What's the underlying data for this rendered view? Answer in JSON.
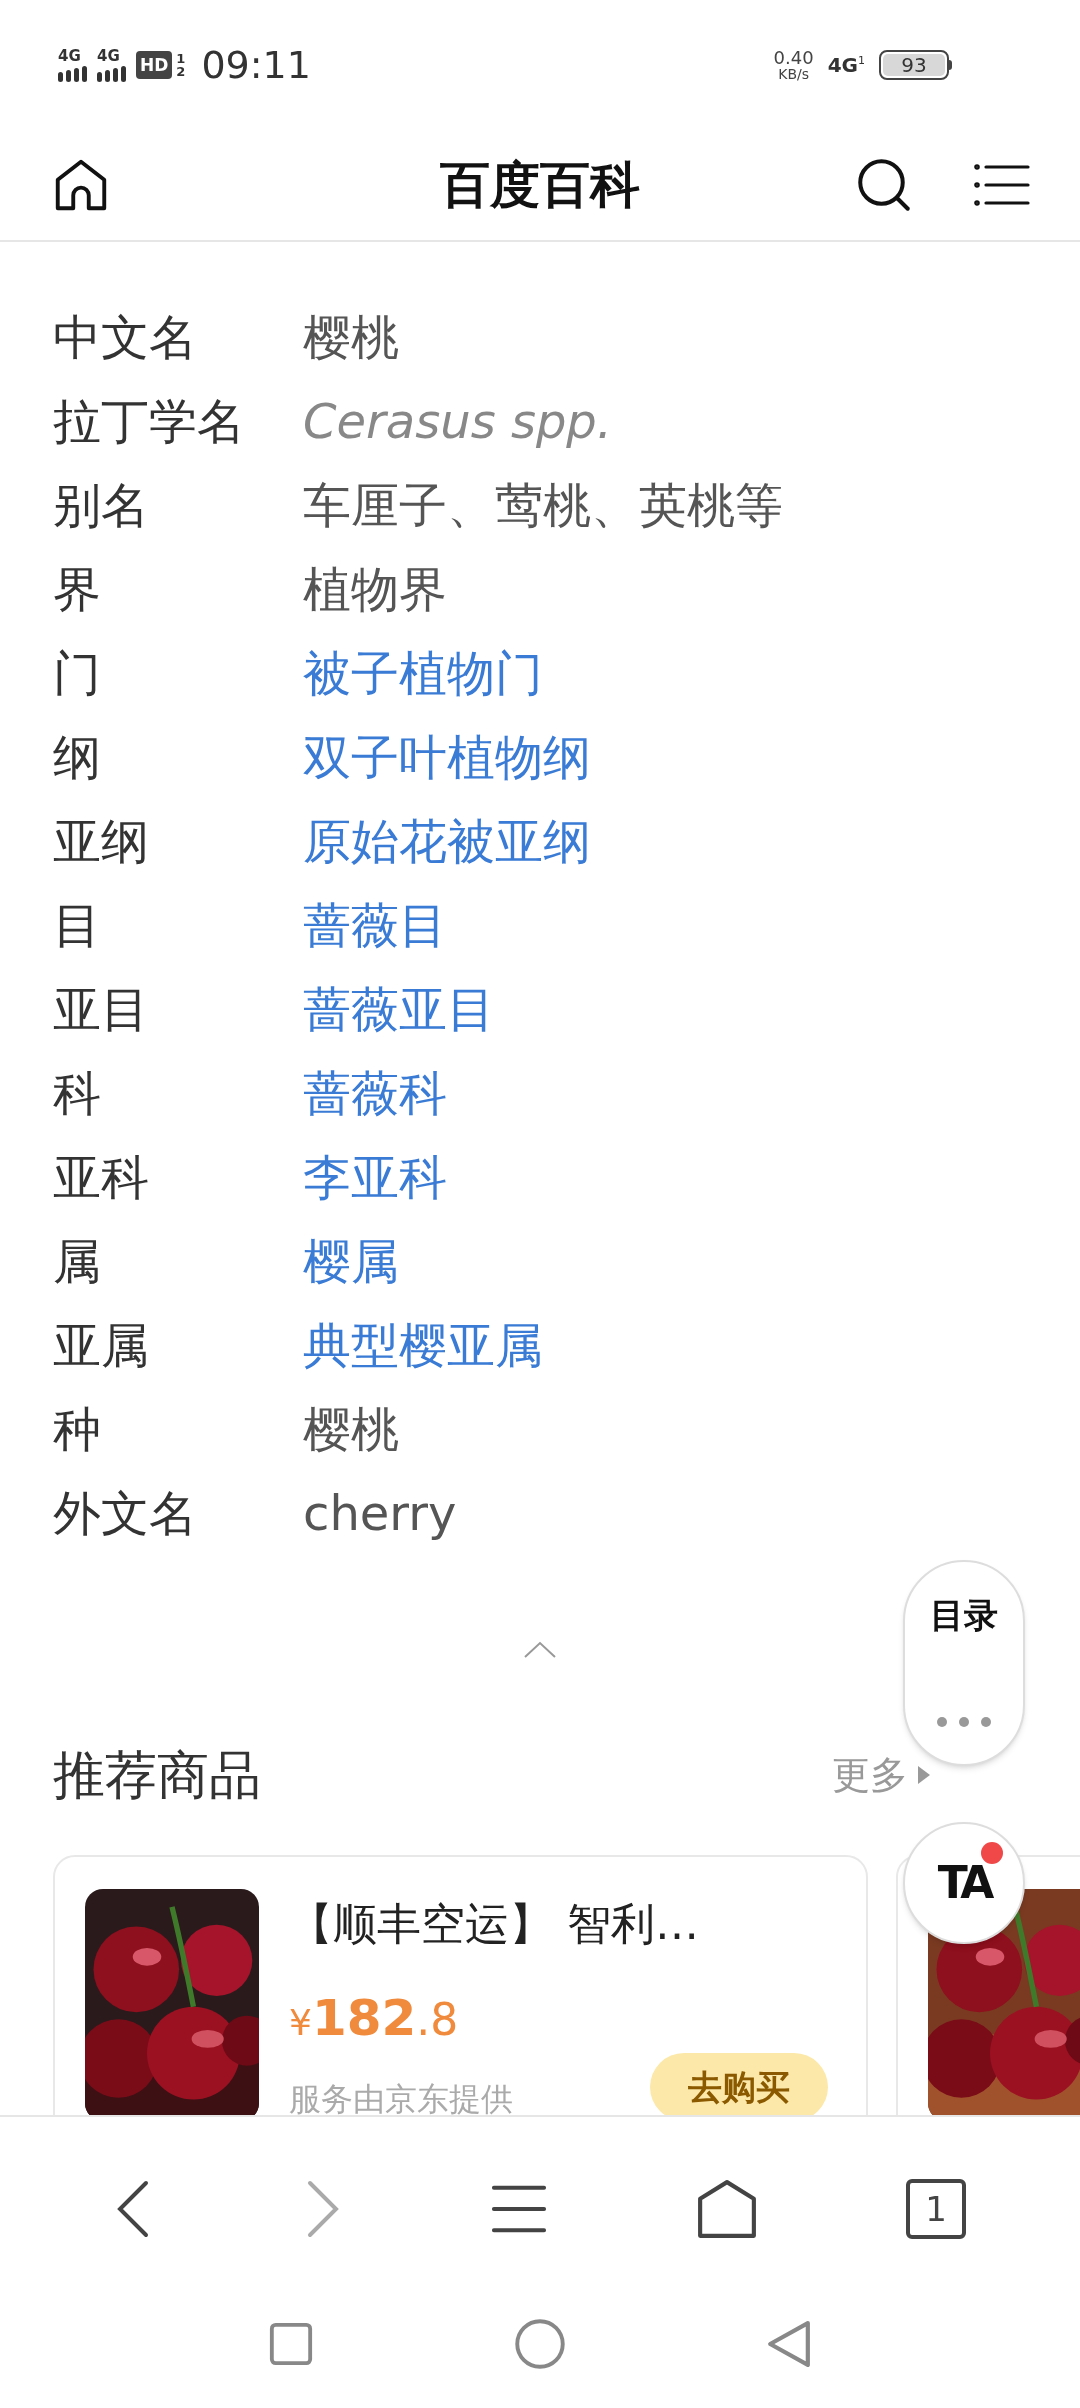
{
  "status_bar": {
    "signal_labels": [
      "4G",
      "4G"
    ],
    "hd": "HD",
    "sim_slots": [
      "1",
      "2"
    ],
    "time": "09:11",
    "speed": "0.40",
    "speed_unit": "KB/s",
    "network": "4G",
    "network_slot": "1",
    "battery": "93"
  },
  "header": {
    "title": "百度百科"
  },
  "info": [
    {
      "label": "中文名",
      "value": "樱桃",
      "kind": "plain"
    },
    {
      "label": "拉丁学名",
      "value": "Cerasus spp.",
      "kind": "italic"
    },
    {
      "label": "别名",
      "value": "车厘子、莺桃、英桃等",
      "kind": "plain"
    },
    {
      "label": "界",
      "value": "植物界",
      "kind": "plain"
    },
    {
      "label": "门",
      "value": "被子植物门",
      "kind": "link"
    },
    {
      "label": "纲",
      "value": "双子叶植物纲",
      "kind": "link"
    },
    {
      "label": "亚纲",
      "value": "原始花被亚纲",
      "kind": "link"
    },
    {
      "label": "目",
      "value": "蔷薇目",
      "kind": "link"
    },
    {
      "label": "亚目",
      "value": "蔷薇亚目",
      "kind": "link"
    },
    {
      "label": "科",
      "value": "蔷薇科",
      "kind": "link"
    },
    {
      "label": "亚科",
      "value": "李亚科",
      "kind": "link"
    },
    {
      "label": "属",
      "value": "樱属",
      "kind": "link"
    },
    {
      "label": "亚属",
      "value": "典型樱亚属",
      "kind": "link"
    },
    {
      "label": "种",
      "value": "樱桃",
      "kind": "plain"
    },
    {
      "label": "外文名",
      "value": "cherry",
      "kind": "plain"
    }
  ],
  "recommend": {
    "title": "推荐商品",
    "more": "更多",
    "products": [
      {
        "kind": "picture",
        "name": "【顺丰空运】 智利…",
        "price": {
          "currency": "¥",
          "integer": "182",
          "decimal": ".8"
        },
        "provider": "服务由京东提供",
        "buy": "去购买"
      },
      {
        "kind": "picture"
      }
    ]
  },
  "floating": {
    "toc": "目录",
    "ta": "TA",
    "ta_unread": true
  },
  "browser_bar": {
    "tab_count": "1",
    "forward_disabled": true
  }
}
